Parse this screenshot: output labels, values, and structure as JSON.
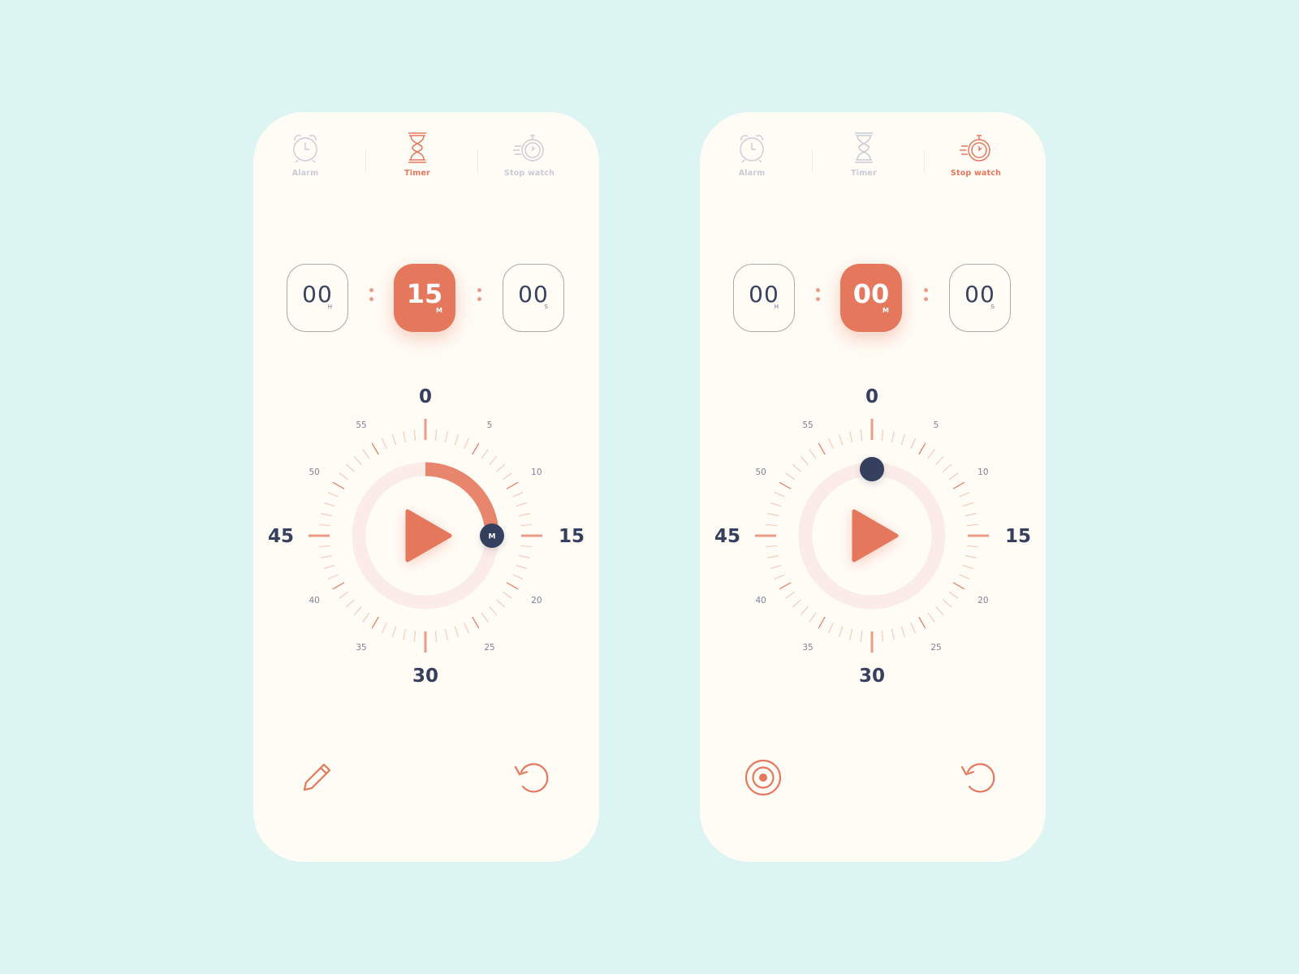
{
  "colors": {
    "background": "#dcf5f2",
    "card": "#fffcf6",
    "accent": "#e5775c",
    "accent_light": "#eb9c86",
    "ring_track": "#fcece8",
    "navy": "#363f5e",
    "inactive": "#c9cbd6"
  },
  "screens": [
    {
      "id": "timer",
      "tabs": [
        {
          "label": "Alarm",
          "icon": "alarm-clock-icon",
          "active": false
        },
        {
          "label": "Timer",
          "icon": "hourglass-icon",
          "active": true
        },
        {
          "label": "Stop watch",
          "icon": "stopwatch-icon",
          "active": false
        }
      ],
      "time": {
        "hours": {
          "value": "00",
          "unit": "H"
        },
        "minutes": {
          "value": "15",
          "unit": "M"
        },
        "seconds": {
          "value": "00",
          "unit": "S"
        }
      },
      "dial": {
        "major_labels": [
          "0",
          "15",
          "30",
          "45"
        ],
        "minor_labels": [
          "5",
          "10",
          "20",
          "25",
          "35",
          "40",
          "50",
          "55"
        ],
        "value_minutes": 15,
        "handle_label": "M",
        "show_progress": true
      },
      "bottom_left": {
        "icon": "pencil-icon",
        "label": "Edit"
      },
      "bottom_right": {
        "icon": "reset-icon",
        "label": "Reset"
      }
    },
    {
      "id": "stopwatch",
      "tabs": [
        {
          "label": "Alarm",
          "icon": "alarm-clock-icon",
          "active": false
        },
        {
          "label": "Timer",
          "icon": "hourglass-icon",
          "active": false
        },
        {
          "label": "Stop watch",
          "icon": "stopwatch-icon",
          "active": true
        }
      ],
      "time": {
        "hours": {
          "value": "00",
          "unit": "H"
        },
        "minutes": {
          "value": "00",
          "unit": "M"
        },
        "seconds": {
          "value": "00",
          "unit": "S"
        }
      },
      "dial": {
        "major_labels": [
          "0",
          "15",
          "30",
          "45"
        ],
        "minor_labels": [
          "5",
          "10",
          "20",
          "25",
          "35",
          "40",
          "50",
          "55"
        ],
        "value_minutes": 0,
        "handle_label": "",
        "show_progress": false
      },
      "bottom_left": {
        "icon": "target-icon",
        "label": "Lap"
      },
      "bottom_right": {
        "icon": "reset-icon",
        "label": "Reset"
      }
    }
  ]
}
